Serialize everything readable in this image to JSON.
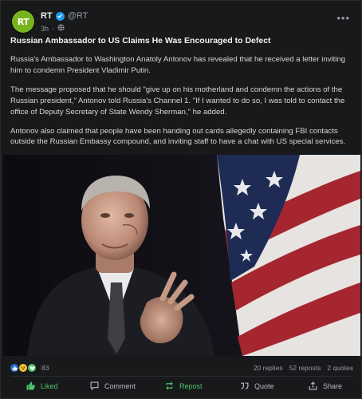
{
  "post": {
    "author": {
      "name": "RT",
      "handle": "@RT",
      "avatar_text": "RT",
      "verified": true
    },
    "time": "3h",
    "visibility_icon": "globe-icon",
    "title": "Russian Ambassador to US Claims He Was Encouraged to Defect",
    "paragraphs": [
      "Russia's Ambassador to Washington Anatoly Antonov has revealed that he received a letter inviting him to condemn President Vladimir Putin.",
      "The message proposed that he should \"give up on his motherland and condemn the actions of the Russian president,\" Antonov told Russia's Channel 1. \"If I wanted to do so, I was told to contact the office of Deputy Secretary of State Wendy Sherman,\" he added.",
      "Antonov also claimed that people have been handing out cards allegedly containing FBI contacts outside the Russian Embassy compound, and inviting staff to have a chat with US special services."
    ]
  },
  "stats": {
    "reaction_count": "83",
    "reaction_icons": [
      "thumbs-up-icon",
      "laugh-emoji-icon",
      "heart-emoji-icon"
    ],
    "replies": "20 replies",
    "reposts": "52 reposts",
    "quotes": "2 quotes"
  },
  "actions": {
    "like": "Liked",
    "comment": "Comment",
    "repost": "Repost",
    "quote": "Quote",
    "share": "Share"
  },
  "colors": {
    "accent_green": "#4cc46b",
    "avatar_green": "#77b31f",
    "verified_blue": "#1d9bf0",
    "card_background": "#18191b"
  }
}
